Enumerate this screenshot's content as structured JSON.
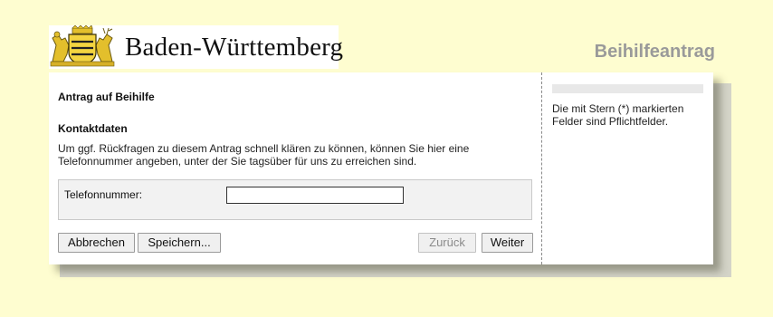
{
  "header": {
    "brand_name": "Baden-Württemberg",
    "app_title": "Beihilfeantrag"
  },
  "form": {
    "title": "Antrag auf Beihilfe",
    "section_title": "Kontaktdaten",
    "section_desc": "Um ggf. Rückfragen zu diesem Antrag schnell klären zu können, können Sie hier eine Telefonnummer angeben, unter der Sie tagsüber für uns zu erreichen sind.",
    "phone_label": "Telefonnummer:",
    "phone_value": ""
  },
  "buttons": {
    "cancel": "Abbrechen",
    "save": "Speichern...",
    "back": "Zurück",
    "next": "Weiter"
  },
  "sidebar": {
    "note": "Die mit Stern (*) markierten Felder sind Pflichtfelder."
  },
  "colors": {
    "page_background": "#fefdd0",
    "title_gray": "#9a9a9a",
    "crest_gold": "#e8c22a"
  },
  "icons": {
    "crest": "baden-wuerttemberg-coat-of-arms-icon"
  }
}
